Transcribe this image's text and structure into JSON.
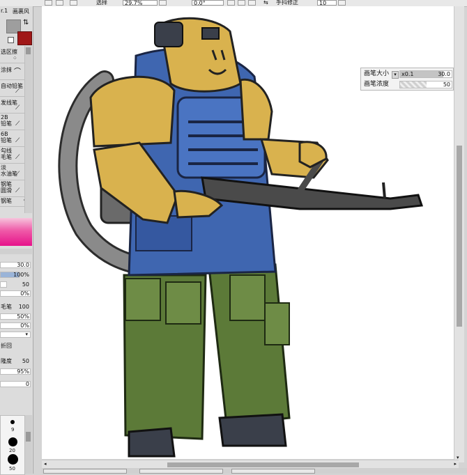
{
  "toolbar": {
    "zoom_label": "选择",
    "zoom_value": "29.7%",
    "angle_value": "0.0°",
    "stabilizer_label": "手抖修正",
    "stabilizer_value": "10"
  },
  "left_panel": {
    "version_text": "r.1",
    "paper_label": "画裹风",
    "tools": [
      {
        "label": "选区擦"
      },
      {
        "label": "涂抹"
      },
      {
        "label": "自动铅笔"
      },
      {
        "label": "发线笔"
      },
      {
        "label": "2B\n铅笔"
      },
      {
        "label": "6B\n铅笔"
      },
      {
        "label": "勾线\n毛笔"
      },
      {
        "label": "淡\n水油笔"
      },
      {
        "label": "钢笔\n圆滑"
      },
      {
        "label": "钢笔"
      }
    ],
    "properties": [
      {
        "label": "",
        "value": "30.0"
      },
      {
        "label": "",
        "value": "100%"
      },
      {
        "label": "",
        "value": "50"
      },
      {
        "label": "",
        "value": "0%"
      },
      {
        "label": "毛笔",
        "value": "100"
      },
      {
        "label": "",
        "value": "50%"
      },
      {
        "label": "",
        "value": "0%"
      },
      {
        "label": "折回",
        "value": ""
      },
      {
        "label": "隆度",
        "value": "50"
      },
      {
        "label": "",
        "value": "95%"
      },
      {
        "label": "",
        "value": "0"
      }
    ],
    "brush_sizes": [
      "9",
      "20",
      "50"
    ]
  },
  "brush_palette": {
    "size_label": "画笔大小",
    "size_multiplier": "x0.1",
    "size_value": "30.0",
    "density_label": "画笔浓度",
    "density_value": "50"
  },
  "colors": {
    "primary": "#a01818",
    "secondary": "#9e9e9e",
    "accent_pink": "#e6128a"
  }
}
